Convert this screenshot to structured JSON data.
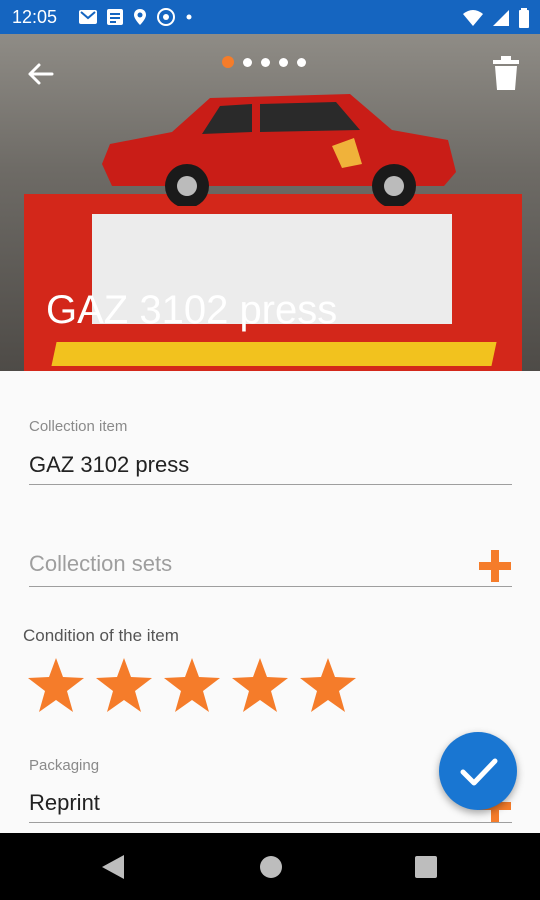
{
  "status_bar": {
    "time": "12:05",
    "icons": [
      "gmail-icon",
      "news-icon",
      "location-icon",
      "vpn-icon",
      "dot-icon"
    ],
    "right_icons": [
      "wifi-icon",
      "signal-icon",
      "battery-icon"
    ]
  },
  "hero": {
    "title": "GAZ 3102 press",
    "page_count": 5,
    "active_page": 1
  },
  "form": {
    "item_label": "Collection item",
    "item_value": "GAZ 3102 press",
    "sets_placeholder": "Collection sets",
    "condition_label": "Condition of the item",
    "condition_rating": 5,
    "condition_max": 5,
    "packaging_label": "Packaging",
    "packaging_value": "Reprint"
  },
  "colors": {
    "accent": "#f57c2a",
    "primary": "#1565c0",
    "fab": "#1976d2"
  }
}
